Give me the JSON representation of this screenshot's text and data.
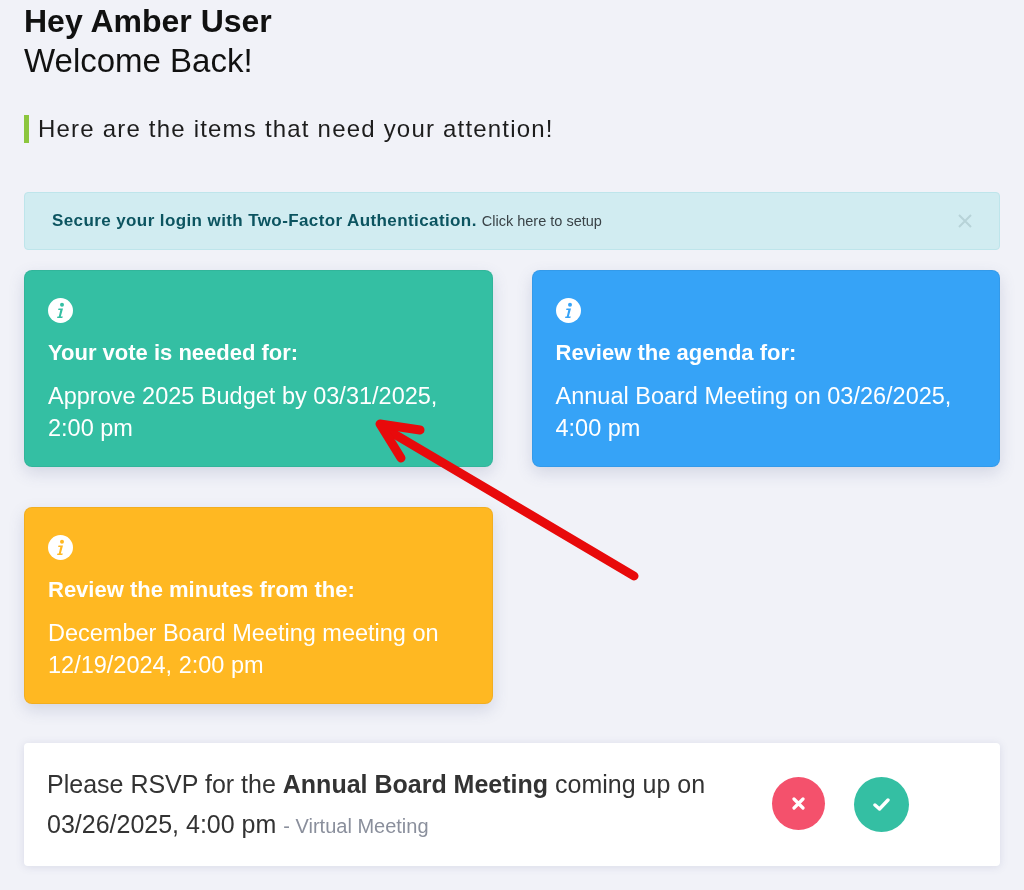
{
  "greeting": {
    "title": "Hey Amber User",
    "subtitle": "Welcome Back!"
  },
  "attention_heading": "Here are the items that need your attention!",
  "alert": {
    "message": "Secure your login with Two-Factor Authentication.",
    "link": "Click here to setup"
  },
  "cards": [
    {
      "color": "#34bfa3",
      "title": "Your vote is needed for:",
      "text": "Approve 2025 Budget by 03/31/2025, 2:00 pm"
    },
    {
      "color": "#36a3f7",
      "title": "Review the agenda for:",
      "text": "Annual Board Meeting on 03/26/2025, 4:00 pm"
    },
    {
      "color": "#ffb822",
      "title": "Review the minutes from the:",
      "text": "December Board Meeting meeting on 12/19/2024, 2:00 pm"
    }
  ],
  "rsvp": {
    "text": "Please RSVP for the **Annual Board Meeting** coming up on 03/26/2025, 4:00 pm",
    "location": "- Virtual Meeting"
  }
}
